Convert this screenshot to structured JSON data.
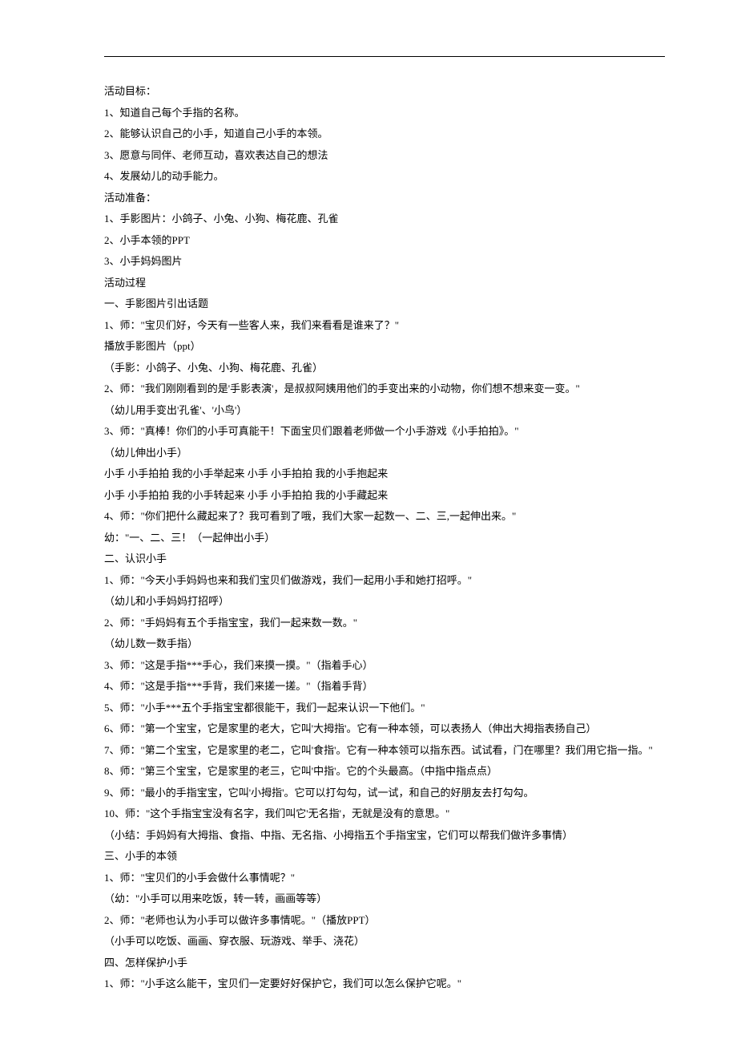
{
  "lines": [
    "活动目标：",
    "1、知道自己每个手指的名称。",
    "2、能够认识自己的小手，知道自己小手的本领。",
    "3、愿意与同伴、老师互动，喜欢表达自己的想法",
    "4、发展幼儿的动手能力。",
    "活动准备：",
    "1、手影图片：小鸽子、小兔、小狗、梅花鹿、孔雀",
    "2、小手本领的PPT",
    "3、小手妈妈图片",
    "活动过程",
    "一、手影图片引出话题",
    "1、师：\"宝贝们好，今天有一些客人来，我们来看看是谁来了？\"",
    "播放手影图片（ppt）",
    "（手影：小鸽子、小兔、小狗、梅花鹿、孔雀）",
    "2、师：\"我们刚刚看到的是'手影表演'，是叔叔阿姨用他们的手变出来的小动物，你们想不想来变一变。\"",
    "（幼儿用手变出'孔雀'、'小鸟'）",
    "3、师：\"真棒！你们的小手可真能干！下面宝贝们跟着老师做一个小手游戏《小手拍拍》。\"",
    "（幼儿伸出小手）",
    "小手 小手拍拍 我的小手举起来 小手 小手拍拍 我的小手抱起来",
    "小手 小手拍拍 我的小手转起来 小手 小手拍拍 我的小手藏起来",
    "4、师：\"你们把什么藏起来了？我可看到了哦，我们大家一起数一、二、三,一起伸出来。\"",
    "幼：\"一、二、三！（一起伸出小手）",
    "二、认识小手",
    "1、师：\"今天小手妈妈也来和我们宝贝们做游戏，我们一起用小手和她打招呼。\"",
    "（幼儿和小手妈妈打招呼）",
    "2、师：\"手妈妈有五个手指宝宝，我们一起来数一数。\"",
    "（幼儿数一数手指）",
    "3、师：\"这是手指***手心，我们来摸一摸。\"（指着手心）",
    "4、师：\"这是手指***手背，我们来搓一搓。\"（指着手背）",
    "5、师：\"小手***五个手指宝宝都很能干，我们一起来认识一下他们。\"",
    "6、师：\"第一个宝宝，它是家里的老大，它叫'大拇指'。它有一种本领，可以表扬人（伸出大拇指表扬自己）",
    "7、师：\"第二个宝宝，它是家里的老二，它叫'食指'。它有一种本领可以指东西。试试看，门在哪里？我们用它指一指。\"",
    "8、师：\"第三个宝宝，它是家里的老三，它叫'中指'。它的个头最高。（中指中指点点）",
    "9、师：\"最小的手指宝宝，它叫'小拇指'。它可以打勾勾，试一试，和自己的好朋友去打勾勾。",
    "10、师：\"这个手指宝宝没有名字，我们叫它'无名指'，无就是没有的意思。\"",
    "（小结：手妈妈有大拇指、食指、中指、无名指、小拇指五个手指宝宝，它们可以帮我们做许多事情）",
    "三、小手的本领",
    "1、师：\"宝贝们的小手会做什么事情呢？\"",
    "（幼：\"小手可以用来吃饭，转一转，画画等等）",
    "2、师：\"老师也认为小手可以做许多事情呢。\"（播放PPT）",
    "（小手可以吃饭、画画、穿衣服、玩游戏、举手、浇花）",
    "四、怎样保护小手",
    "1、师：\"小手这么能干，宝贝们一定要好好保护它，我们可以怎么保护它呢。\""
  ]
}
